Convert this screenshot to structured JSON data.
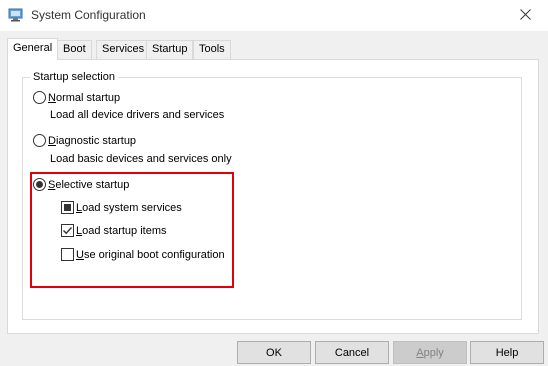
{
  "window": {
    "title": "System Configuration"
  },
  "tabs": [
    {
      "label": "General",
      "active": true
    },
    {
      "label": "Boot"
    },
    {
      "label": "Services"
    },
    {
      "label": "Startup"
    },
    {
      "label": "Tools"
    }
  ],
  "startup_selection": {
    "group_title": "Startup selection",
    "normal": {
      "label_first": "N",
      "label_rest": "ormal startup",
      "desc": "Load all device drivers and services",
      "selected": false
    },
    "diagnostic": {
      "label_first": "D",
      "label_rest": "iagnostic startup",
      "desc": "Load basic devices and services only",
      "selected": false
    },
    "selective": {
      "label_first": "S",
      "label_rest": "elective startup",
      "selected": true,
      "options": [
        {
          "label_first": "L",
          "label_rest": "oad system services",
          "state": "indeterminate"
        },
        {
          "label_first": "L",
          "label_rest": "oad startup items",
          "state": "checked"
        },
        {
          "label_first": "U",
          "label_rest": "se original boot configuration",
          "state": "unchecked"
        }
      ]
    }
  },
  "buttons": {
    "ok": "OK",
    "cancel": "Cancel",
    "apply_first": "A",
    "apply_rest": "pply",
    "help": "Help"
  },
  "colors": {
    "highlight": "#e0000a"
  },
  "icons": {
    "app": "system-config-icon",
    "close": "close-icon"
  }
}
